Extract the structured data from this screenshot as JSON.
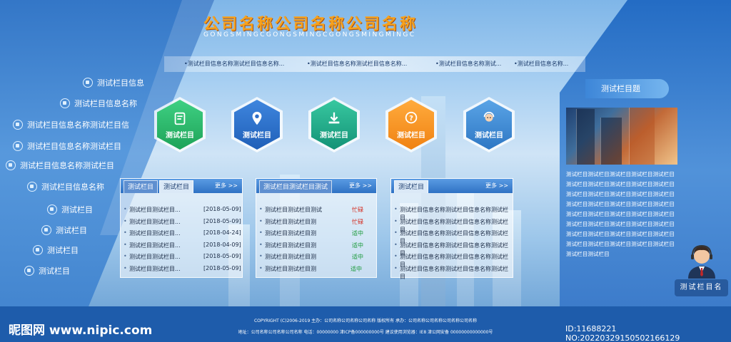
{
  "header": {
    "company": "公司名称公司名称公司名称",
    "company_en": "GONGSMINGCGONGSMINGCGONGSMINGMINGC"
  },
  "ticker": [
    "•测试栏目信息名称测试栏目信息名称...",
    "•测试栏目信息名称测试栏目信息名称...",
    "•测试栏目信息名称测试...",
    "•测试栏目信息名称..."
  ],
  "sidebar": {
    "items": [
      {
        "label": "测试栏目信息",
        "icon": "user-icon"
      },
      {
        "label": "测试栏目信息名称",
        "icon": "document-icon"
      },
      {
        "label": "测试栏目信息名称测试栏目信",
        "icon": "id-card-icon"
      },
      {
        "label": "测试栏目信息名称测试栏目",
        "icon": "user-icon"
      },
      {
        "label": "测试栏目信息名称测试栏目",
        "icon": "card-icon"
      },
      {
        "label": "测试栏目信息名称",
        "icon": "globe-icon"
      },
      {
        "label": "测试栏目",
        "icon": "scale-icon"
      },
      {
        "label": "测试栏目",
        "icon": "edit-icon"
      },
      {
        "label": "测试栏目",
        "icon": "mail-icon"
      },
      {
        "label": "测试栏目",
        "icon": "compass-icon"
      }
    ]
  },
  "tiles": [
    {
      "label": "测试栏目",
      "icon": "notepad-icon",
      "color": "#2cb86a"
    },
    {
      "label": "测试栏目",
      "icon": "map-pin-icon",
      "color": "#2f6fc9"
    },
    {
      "label": "测试栏目",
      "icon": "download-icon",
      "color": "#1fae8c"
    },
    {
      "label": "测试栏目",
      "icon": "question-icon",
      "color": "#f6921e"
    },
    {
      "label": "测试栏目",
      "icon": "support-agent-icon",
      "color": "#3c8bd3"
    }
  ],
  "box1": {
    "tabs": [
      "测试栏目",
      "测试栏目"
    ],
    "more": "更多 >>",
    "rows": [
      {
        "title": "测试栏目测试栏目...",
        "date": "[2018-05-09]"
      },
      {
        "title": "测试栏目测试栏目...",
        "date": "[2018-05-09]"
      },
      {
        "title": "测试栏目测试栏目...",
        "date": "[2018-04-24]"
      },
      {
        "title": "测试栏目测试栏目...",
        "date": "[2018-04-09]"
      },
      {
        "title": "测试栏目测试栏目...",
        "date": "[2018-05-09]"
      },
      {
        "title": "测试栏目测试栏目...",
        "date": "[2018-05-09]"
      }
    ]
  },
  "box2": {
    "tabs": [
      "测试栏目测试栏目测试"
    ],
    "more": "更多 >>",
    "rows": [
      {
        "title": "测试栏目测试栏目测试",
        "status": "忙碌",
        "color": "#d42a1e"
      },
      {
        "title": "测试栏目测试栏目测",
        "status": "忙碌",
        "color": "#d42a1e"
      },
      {
        "title": "测试栏目测试栏目测",
        "status": "适中",
        "color": "#1a9a3a"
      },
      {
        "title": "测试栏目测试栏目测",
        "status": "适中",
        "color": "#1a9a3a"
      },
      {
        "title": "测试栏目测试栏目测",
        "status": "适中",
        "color": "#1a9a3a"
      },
      {
        "title": "测试栏目测试栏目测",
        "status": "适中",
        "color": "#1a9a3a"
      }
    ]
  },
  "box3": {
    "tabs": [
      "测试栏目"
    ],
    "more": "更多 >>",
    "rows": [
      "测试栏目信息名称测试栏目信息名称测试栏目",
      "测试栏目信息名称测试栏目信息名称测试栏目",
      "测试栏目信息名称测试栏目信息名称测试栏目",
      "测试栏目信息名称测试栏目信息名称测试栏目",
      "测试栏目信息名称测试栏目信息名称测试栏目",
      "测试栏目信息名称测试栏目信息名称测试栏目"
    ]
  },
  "right": {
    "title": "测试栏目题",
    "text": [
      "测试栏目测试栏目测试栏目测试栏目测试栏目",
      "测试栏目测试栏目测试栏目测试栏目测试栏目",
      "测试栏目测试栏目测试栏目测试栏目测试栏目",
      "测试栏目测试栏目测试栏目测试栏目测试栏目",
      "测试栏目测试栏目测试栏目测试栏目测试栏目",
      "测试栏目测试栏目测试栏目测试栏目测试栏目",
      "测试栏目测试栏目测试栏目测试栏目测试栏目",
      "测试栏目测试栏目测试栏目测试栏目测试栏目",
      "测试栏目测试栏目"
    ],
    "support_label": "测试栏目名"
  },
  "footer": {
    "line1": "COPYRIGHT (C)2006-2019 主办：公司名称公司名称公司名称  版权所有  承办：公司名称公司名称公司名称公司名称",
    "line2": "地址：公司名称公司名称公司名称  电话：00000000  津ICP备000000000号  建议使用浏览器：IE8  津公网安备  00000000000000号",
    "watermark": "昵图网 www.nipic.com",
    "id": "ID:11688221 NO:20220329150502166129"
  }
}
